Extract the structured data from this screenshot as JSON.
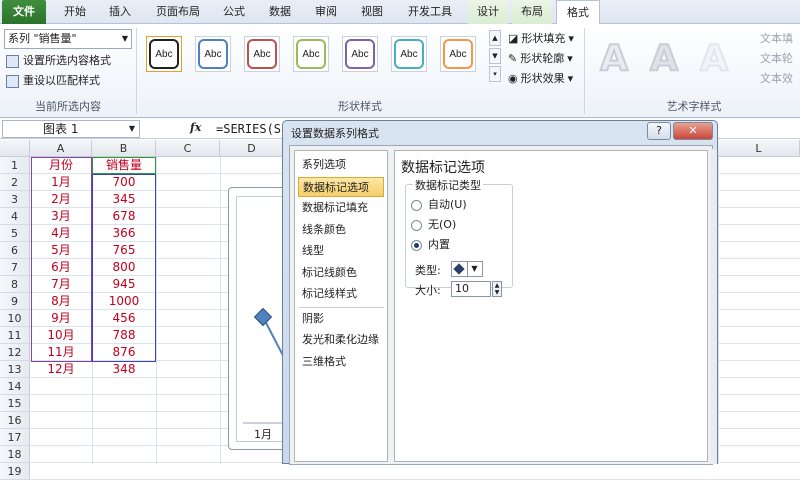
{
  "tabs": {
    "file": "文件",
    "home": "开始",
    "insert": "插入",
    "layout": "页面布局",
    "formulas": "公式",
    "data": "数据",
    "review": "审阅",
    "view": "视图",
    "developer": "开发工具",
    "design": "设计",
    "chart_layout": "布局",
    "format": "格式"
  },
  "current_selection": {
    "selected": "系列 \"销售量\"",
    "format_btn": "设置所选内容格式",
    "reset_btn": "重设以匹配样式",
    "group_label": "当前所选内容"
  },
  "shape_styles": {
    "swatch_text": "Abc",
    "swatch_colors": [
      "#222222",
      "#4f81bd",
      "#c0504d",
      "#9bbb59",
      "#8064a2",
      "#4bacc6",
      "#f79646"
    ],
    "fill": "形状填充",
    "outline": "形状轮廓",
    "effects": "形状效果",
    "group_label": "形状样式"
  },
  "wordart": {
    "letter": "A",
    "text_fill": "文本填",
    "text_outline": "文本轮",
    "text_effects": "文本效",
    "group_label": "艺术字样式"
  },
  "formula_bar": {
    "name_box": "图表 1",
    "fx": "fx",
    "formula": "=SERIES(S"
  },
  "columns": [
    "A",
    "B",
    "C",
    "D",
    "L"
  ],
  "headers": {
    "month": "月份",
    "sales": "销售量"
  },
  "rows": [
    {
      "month": "1月",
      "sales": "700"
    },
    {
      "month": "2月",
      "sales": "345"
    },
    {
      "month": "3月",
      "sales": "678"
    },
    {
      "month": "4月",
      "sales": "366"
    },
    {
      "month": "5月",
      "sales": "765"
    },
    {
      "month": "6月",
      "sales": "800"
    },
    {
      "month": "7月",
      "sales": "945"
    },
    {
      "month": "8月",
      "sales": "1000"
    },
    {
      "month": "9月",
      "sales": "456"
    },
    {
      "month": "10月",
      "sales": "788"
    },
    {
      "month": "11月",
      "sales": "876"
    },
    {
      "month": "12月",
      "sales": "348"
    }
  ],
  "row_numbers": [
    "1",
    "2",
    "3",
    "4",
    "5",
    "6",
    "7",
    "8",
    "9",
    "10",
    "11",
    "12",
    "13",
    "14",
    "15",
    "16",
    "17",
    "18",
    "19"
  ],
  "chart_label": "1月",
  "dialog": {
    "title": "设置数据系列格式",
    "help": "?",
    "close": "✕",
    "nav": [
      "系列选项",
      "数据标记选项",
      "数据标记填充",
      "线条颜色",
      "线型",
      "标记线颜色",
      "标记线样式",
      "阴影",
      "发光和柔化边缘",
      "三维格式"
    ],
    "panel_title": "数据标记选项",
    "group_title": "数据标记类型",
    "options": [
      "自动(U)",
      "无(O)",
      "内置"
    ],
    "type_label": "类型:",
    "size_label": "大小:",
    "size_value": "10"
  }
}
